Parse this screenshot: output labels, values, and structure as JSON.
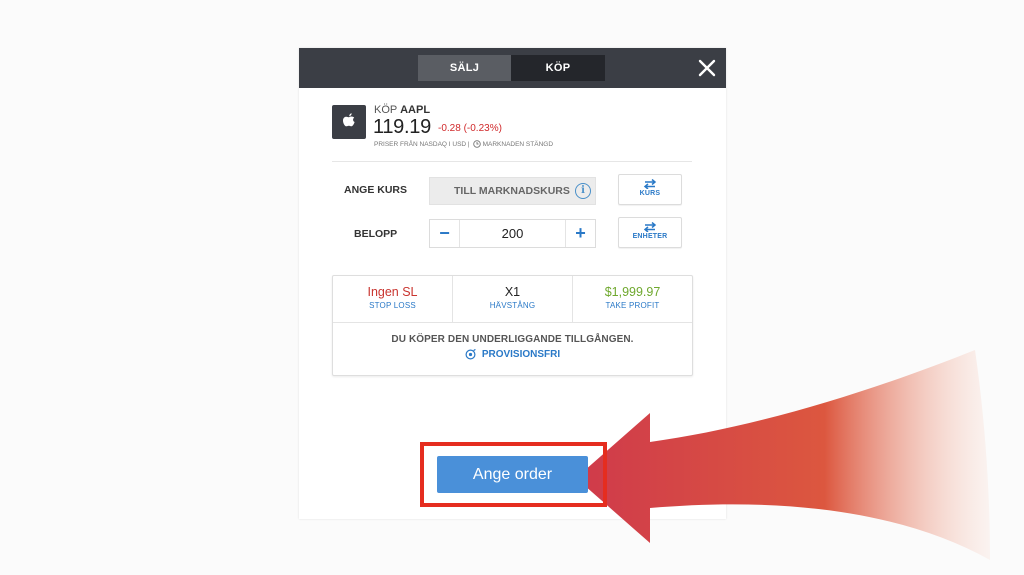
{
  "tabs": [
    {
      "label": "SÄLJ",
      "active": true
    },
    {
      "label": "KÖP",
      "active": false
    }
  ],
  "header": {
    "action": "KÖP",
    "symbol": "AAPL",
    "price": "119.19",
    "change": "-0.28 (-0.23%)",
    "source": "PRISER FRÅN NASDAQ I USD |",
    "market_status": "MARKNADEN STÄNGD"
  },
  "rate": {
    "label": "ANGE KURS",
    "value": "TILL MARKNADSKURS",
    "switch_label": "KURS"
  },
  "amount": {
    "label": "BELOPP",
    "value": "200",
    "minus": "−",
    "plus": "+",
    "switch_label": "ENHETER"
  },
  "summary": {
    "stop_loss_value": "Ingen SL",
    "stop_loss_label": "STOP LOSS",
    "leverage_value": "X1",
    "leverage_label": "HÄVSTÅNG",
    "take_profit_value": "$1,999.97",
    "take_profit_label": "TAKE PROFIT",
    "note": "DU KÖPER DEN UNDERLIGGANDE TILLGÅNGEN.",
    "commission": "PROVISIONSFRI"
  },
  "submit_label": "Ange order",
  "colors": {
    "topbar": "#3b3e45",
    "accent_blue": "#2a79c7",
    "button_blue": "#4a90d9",
    "negative_red": "#d0292b",
    "stop_loss_red": "#c9342f",
    "profit_green": "#6fa82e",
    "highlight_red": "#e52d1f"
  },
  "icons": [
    "close-icon",
    "apple-logo-icon",
    "clock-icon",
    "info-icon",
    "swap-arrows-icon",
    "commission-badge-icon",
    "pointer-arrow"
  ]
}
